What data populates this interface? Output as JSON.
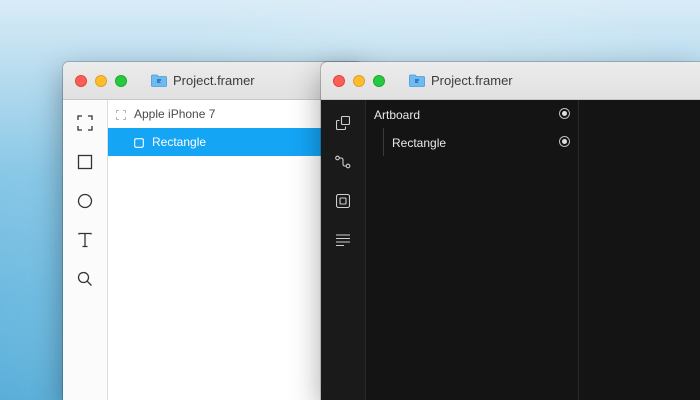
{
  "windows": {
    "light": {
      "title": "Project.framer",
      "tools": [
        "frame-icon",
        "rectangle-icon",
        "oval-icon",
        "text-icon",
        "search-icon"
      ],
      "layers": [
        {
          "label": "Apple iPhone 7",
          "icon": "device-frame-icon",
          "selected": false
        },
        {
          "label": "Rectangle",
          "icon": "rectangle-layer-icon",
          "selected": true
        }
      ]
    },
    "dark": {
      "title": "Project.framer",
      "tools": [
        "copy-layers-icon",
        "connect-icon",
        "component-icon",
        "list-icon"
      ],
      "layers": [
        {
          "label": "Artboard"
        },
        {
          "label": "Rectangle"
        }
      ]
    }
  },
  "colors": {
    "selection": "#14a5f5",
    "dark_background": "#141414",
    "traffic_red": "#fd5f57",
    "traffic_yellow": "#febc2e",
    "traffic_green": "#28c840"
  }
}
